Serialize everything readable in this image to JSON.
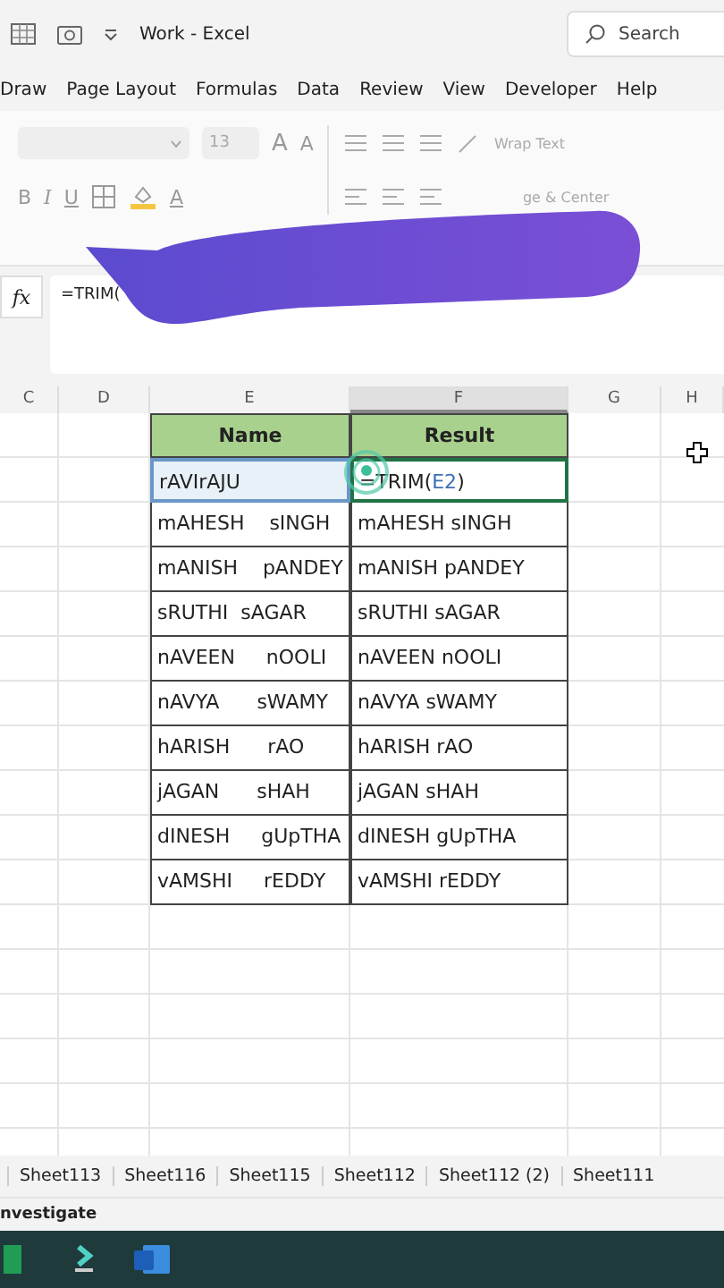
{
  "title_bar": {
    "title": "Work - Excel",
    "search": {
      "placeholder": "Search"
    }
  },
  "ribbon_tabs": [
    {
      "label": "Draw",
      "selected": false
    },
    {
      "label": "Page Layout",
      "selected": false
    },
    {
      "label": "Formulas",
      "selected": false
    },
    {
      "label": "Data",
      "selected": false
    },
    {
      "label": "Review",
      "selected": false
    },
    {
      "label": "View",
      "selected": false
    },
    {
      "label": "Developer",
      "selected": false
    },
    {
      "label": "Help",
      "selected": false
    }
  ],
  "ribbon": {
    "font_size": "13",
    "grow": "A",
    "shrink": "A",
    "format_buttons": [
      "B",
      "I",
      "U"
    ],
    "font_color": "A",
    "wrap_text": "Wrap Text",
    "merge": "ge & Center"
  },
  "formula_bar": {
    "fx": "fx",
    "value": "=TRIM("
  },
  "columns": [
    "C",
    "D",
    "E",
    "F",
    "G",
    "H"
  ],
  "table": {
    "headers": [
      "Name",
      "Result"
    ],
    "rows": [
      {
        "name": "rAVIrAJU",
        "formula": [
          "=TRIM(",
          "E2",
          ")"
        ],
        "active": true
      },
      {
        "name": "mAHESH    sINGH",
        "result": "mAHESH sINGH",
        "active": false
      },
      {
        "name": "mANISH    pANDEY",
        "result": "mANISH pANDEY",
        "active": false
      },
      {
        "name": "sRUTHI  sAGAR",
        "result": "sRUTHI sAGAR",
        "active": false
      },
      {
        "name": "nAVEEN     nOOLI",
        "result": "nAVEEN nOOLI",
        "active": false
      },
      {
        "name": "nAVYA      sWAMY",
        "result": "nAVYA sWAMY",
        "active": false
      },
      {
        "name": "hARISH      rAO",
        "result": "hARISH rAO",
        "active": false
      },
      {
        "name": "jAGAN      sHAH",
        "result": "jAGAN sHAH",
        "active": false
      },
      {
        "name": "dINESH     gUpTHA",
        "result": "dINESH gUpTHA",
        "active": false
      },
      {
        "name": "vAMSHI     rEDDY",
        "result": "vAMSHI rEDDY",
        "active": false
      }
    ]
  },
  "sheet_tabs": [
    {
      "label": "Sheet113",
      "selected": false
    },
    {
      "label": "Sheet116",
      "selected": false
    },
    {
      "label": "Sheet115",
      "selected": false
    },
    {
      "label": "Sheet112",
      "selected": false
    },
    {
      "label": "Sheet112 (2)",
      "selected": false
    },
    {
      "label": "Sheet111",
      "selected": false
    }
  ],
  "status_bar": {
    "text": "nvestigate"
  }
}
